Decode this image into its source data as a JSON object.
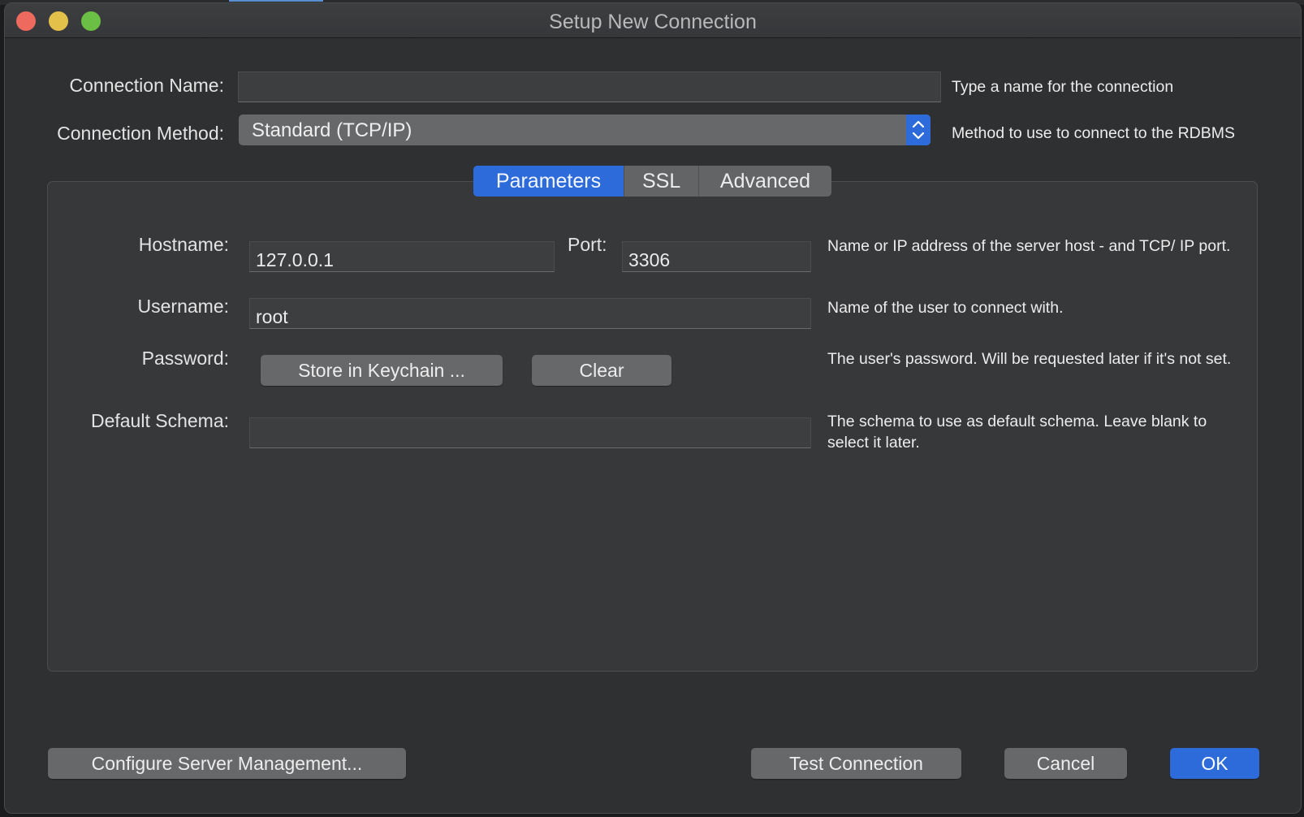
{
  "window": {
    "title": "Setup New Connection",
    "controls": {
      "close": "close-icon",
      "minimize": "minimize-icon",
      "zoom": "zoom-icon"
    }
  },
  "connection_name": {
    "label": "Connection Name:",
    "value": "",
    "hint": "Type a name for the connection"
  },
  "connection_method": {
    "label": "Connection Method:",
    "value": "Standard (TCP/IP)",
    "hint": "Method to use to connect to the RDBMS"
  },
  "tabs": [
    {
      "label": "Parameters",
      "active": true
    },
    {
      "label": "SSL",
      "active": false
    },
    {
      "label": "Advanced",
      "active": false
    }
  ],
  "parameters": {
    "hostname": {
      "label": "Hostname:",
      "value": "127.0.0.1"
    },
    "port": {
      "label": "Port:",
      "value": "3306"
    },
    "host_hint": "Name or IP address of the server host - and TCP/ IP port.",
    "username": {
      "label": "Username:",
      "value": "root",
      "hint": "Name of the user to connect with."
    },
    "password": {
      "label": "Password:",
      "store_button": "Store in Keychain ...",
      "clear_button": "Clear",
      "hint": "The user's password. Will be requested later if it's not set."
    },
    "default_schema": {
      "label": "Default Schema:",
      "value": "",
      "hint": "The schema to use as default schema. Leave blank to select it later."
    }
  },
  "footer": {
    "configure_button": "Configure Server Management...",
    "test_button": "Test Connection",
    "cancel_button": "Cancel",
    "ok_button": "OK"
  },
  "colors": {
    "accent": "#2d6bdb",
    "window_bg": "#2f3032",
    "panel_bg": "#37383a",
    "button_bg": "#67686a",
    "close": "#ee6a5e",
    "minimize": "#e3c04a",
    "zoom": "#6cbf45"
  }
}
